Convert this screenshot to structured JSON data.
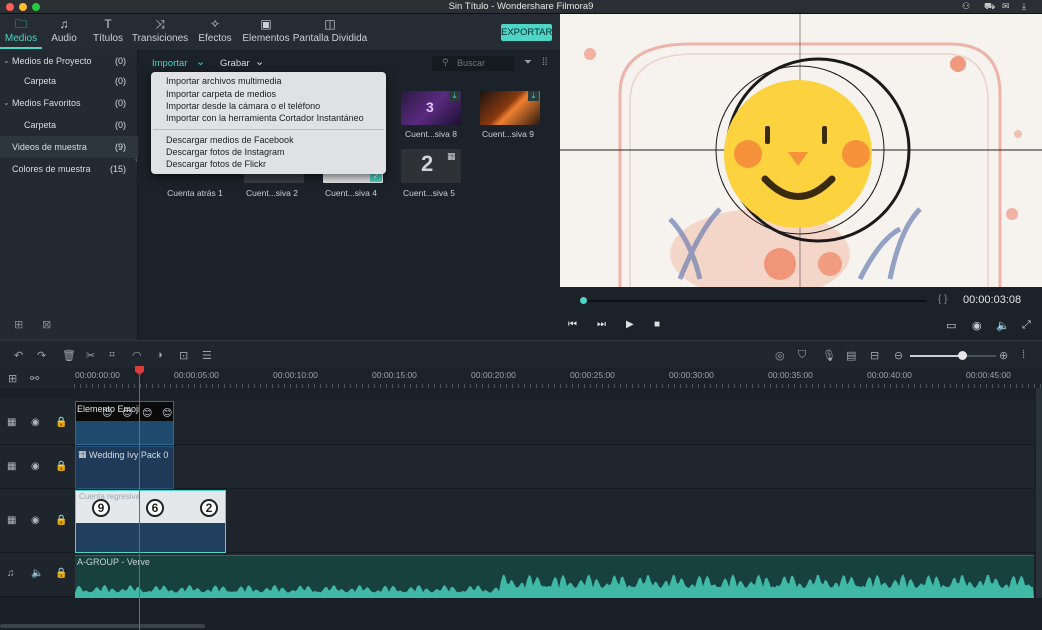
{
  "window": {
    "title": "Sin Título - Wondershare Filmora9"
  },
  "top_tabs": [
    {
      "label": "Medios",
      "icon": "folder-icon",
      "glyph": "🗀"
    },
    {
      "label": "Audio",
      "icon": "music-note-icon",
      "glyph": "♫"
    },
    {
      "label": "Títulos",
      "icon": "text-icon",
      "glyph": "T"
    },
    {
      "label": "Transiciones",
      "icon": "transition-icon",
      "glyph": "⤨"
    },
    {
      "label": "Efectos",
      "icon": "effects-icon",
      "glyph": "✧"
    },
    {
      "label": "Elementos",
      "icon": "image-icon",
      "glyph": "▣"
    },
    {
      "label": "Pantalla Dividida",
      "icon": "split-screen-icon",
      "glyph": "◫"
    }
  ],
  "export_label": "EXPORTAR",
  "sidebar": {
    "items": [
      {
        "label": "Medios de Proyecto",
        "count": "(0)",
        "expanded": true
      },
      {
        "label": "Carpeta",
        "count": "(0)",
        "sub": true
      },
      {
        "label": "Medios Favoritos",
        "count": "(0)",
        "expanded": true
      },
      {
        "label": "Carpeta",
        "count": "(0)",
        "sub": true
      },
      {
        "label": "Videos de muestra",
        "count": "(9)",
        "selected": true
      },
      {
        "label": "Colores de muestra",
        "count": "(15)"
      }
    ]
  },
  "media_toolbar": {
    "import_label": "Importar",
    "record_label": "Grabar",
    "search_placeholder": "Buscar"
  },
  "import_menu": {
    "items": [
      "Importar archivos multimedia",
      "Importar carpeta de medios",
      "Importar desde la cámara o el teléfono",
      "Importar con la herramienta Cortador Instantáneo"
    ],
    "download_items": [
      "Descargar medios de Facebook",
      "Descargar fotos de Instagram",
      "Descargar fotos de Flickr"
    ]
  },
  "media_items": [
    {
      "caption": "Cuent...siva 8",
      "overlay": "3"
    },
    {
      "caption": "Cuent...siva 9",
      "overlay": ""
    },
    {
      "caption": "Cuenta atrás 1",
      "overlay": ""
    },
    {
      "caption": "Cuent...siva 2",
      "overlay": ""
    },
    {
      "caption": "Cuent...siva 4",
      "overlay": ""
    },
    {
      "caption": "Cuent...siva 5",
      "overlay": "2"
    }
  ],
  "player": {
    "timecode": "00:00:03:08",
    "progress_fraction": 0.0,
    "markers": "{ }"
  },
  "ruler_labels": [
    "00:00:00:00",
    "00:00:05:00",
    "00:00:10:00",
    "00:00:15:00",
    "00:00:20:00",
    "00:00:25:00",
    "00:00:30:00",
    "00:00:35:00",
    "00:00:40:00",
    "00:00:45:00"
  ],
  "timeline": {
    "clip1_label": "Elemento Emoji",
    "clip2_label": "Wedding Ivy Pack 0",
    "clip3_label": "Cuenta regresiva",
    "clip3_numbers": [
      "9",
      "6",
      "2"
    ],
    "audio_label": "A-GROUP - Verve",
    "zoom_level_fraction": 0.6
  },
  "colors": {
    "accent": "#4dd5c6",
    "playhead": "#e23a3a",
    "audio_wave": "#3fb8a6"
  }
}
